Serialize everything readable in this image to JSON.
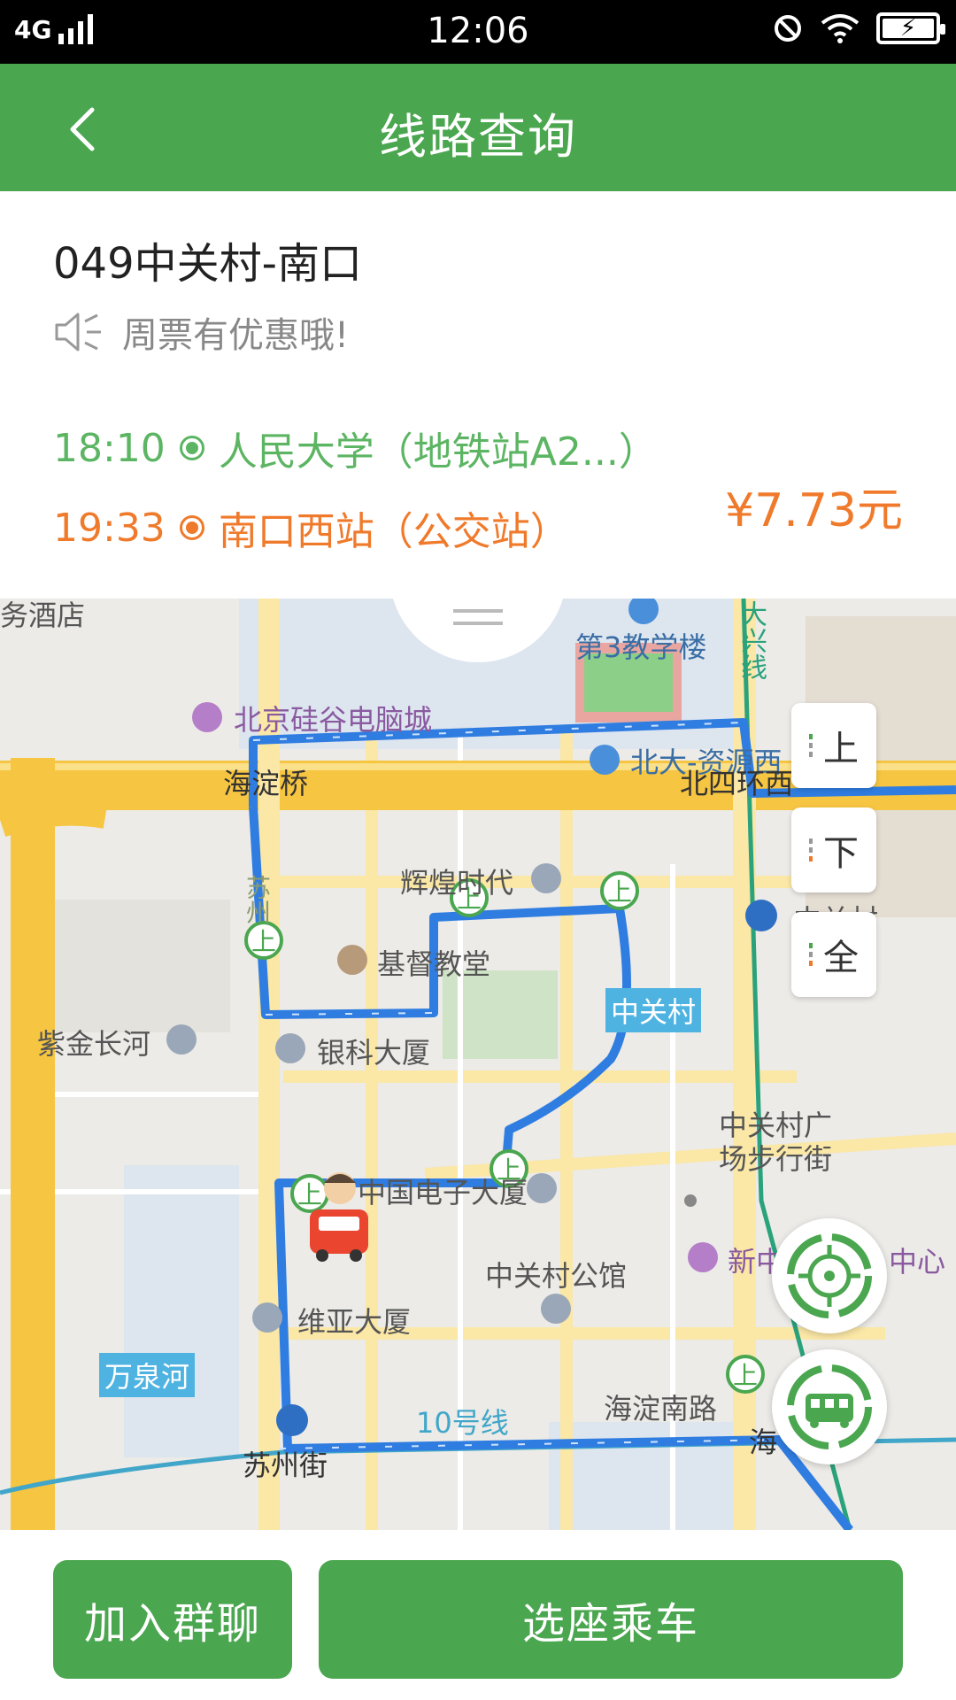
{
  "status_bar": {
    "network": "4G",
    "time": "12:06"
  },
  "header": {
    "title": "线路查询"
  },
  "route": {
    "name": "049中关村-南口",
    "promo": "周票有优惠哦!",
    "departure": {
      "time": "18:10",
      "station": "人民大学（地铁站A2...）"
    },
    "arrival": {
      "time": "19:33",
      "station": "南口西站（公交站）"
    },
    "price": "¥7.73元"
  },
  "map": {
    "labels": {
      "hotel": "务酒店",
      "building3": "第3教学楼",
      "daxing_line": "大兴线",
      "mall": "北京硅谷电脑城",
      "pku": "北大-资源西",
      "bridge": "海淀桥",
      "ring_road": "北四环西",
      "huihuang": "辉煌时代",
      "zhongguancun_top": "中关村",
      "suzhou": "苏州",
      "church": "基督教堂",
      "zhongguancun_station": "中关村",
      "zijin": "紫金长河",
      "yinke": "银科大厦",
      "plaza": "中关村广场步行街",
      "electronics": "中国电子大厦",
      "gongguan": "中关村公馆",
      "newcenter_left": "新中",
      "newcenter_right": "中心",
      "weiya": "维亚大厦",
      "wanquan": "万泉河",
      "line10": "10号线",
      "haidian_south": "海淀南路",
      "suzhoujie": "苏州街",
      "hai": "海",
      "board": "上"
    },
    "direction_buttons": [
      "上",
      "下",
      "全"
    ],
    "colors": {
      "route": "#2f7de1",
      "major_road": "#f6c541",
      "minor_road": "#fbe7a6",
      "stop": "#4aa64f"
    }
  },
  "actions": {
    "join_chat": "加入群聊",
    "select_seat": "选座乘车"
  },
  "colors": {
    "brand_green": "#4aa64f",
    "departure_green": "#5cb563",
    "arrival_orange": "#f07a2b"
  }
}
